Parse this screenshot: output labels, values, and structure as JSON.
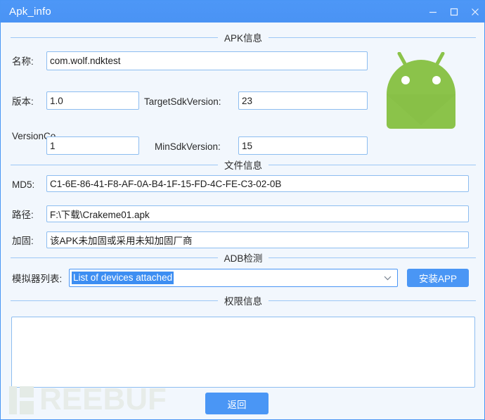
{
  "window": {
    "title": "Apk_info",
    "controls": {
      "minimize": "minimize-icon",
      "maximize": "maximize-icon",
      "close": "close-icon"
    },
    "colors": {
      "titlebar": "#4a96f5",
      "background": "#f2f7fd",
      "accent": "#4a96f5",
      "field_border": "#8dbdf0",
      "group_line": "#9dc7f5",
      "android_green": "#8bc34a",
      "watermark": "#e7ece9"
    }
  },
  "groups": {
    "apk_info": "APK信息",
    "file_info": "文件信息",
    "adb_check": "ADB检测",
    "permission_info": "权限信息"
  },
  "apk_info": {
    "name_label": "名称:",
    "name_value": "com.wolf.ndktest",
    "version_label": "版本:",
    "version_value": "1.0",
    "target_sdk_label": "TargetSdkVersion:",
    "target_sdk_value": "23",
    "version_code_label": "VersionCo",
    "version_code_value": "1",
    "min_sdk_label": "MinSdkVersion:",
    "min_sdk_value": "15",
    "logo": "android-robot-icon"
  },
  "file_info": {
    "md5_label": "MD5:",
    "md5_value": "C1-6E-86-41-F8-AF-0A-B4-1F-15-FD-4C-FE-C3-02-0B",
    "path_label": "路径:",
    "path_value": "F:\\下载\\Crakeme01.apk",
    "packer_label": "加固:",
    "packer_value": "该APK未加固或采用未知加固厂商"
  },
  "adb": {
    "device_list_label": "模拟器列表:",
    "selected_device": "List of devices attached",
    "install_button": "安装APP"
  },
  "permission": {
    "content": "",
    "placeholder": ""
  },
  "footer": {
    "return_button": "返回",
    "watermark": "REEBUF"
  }
}
